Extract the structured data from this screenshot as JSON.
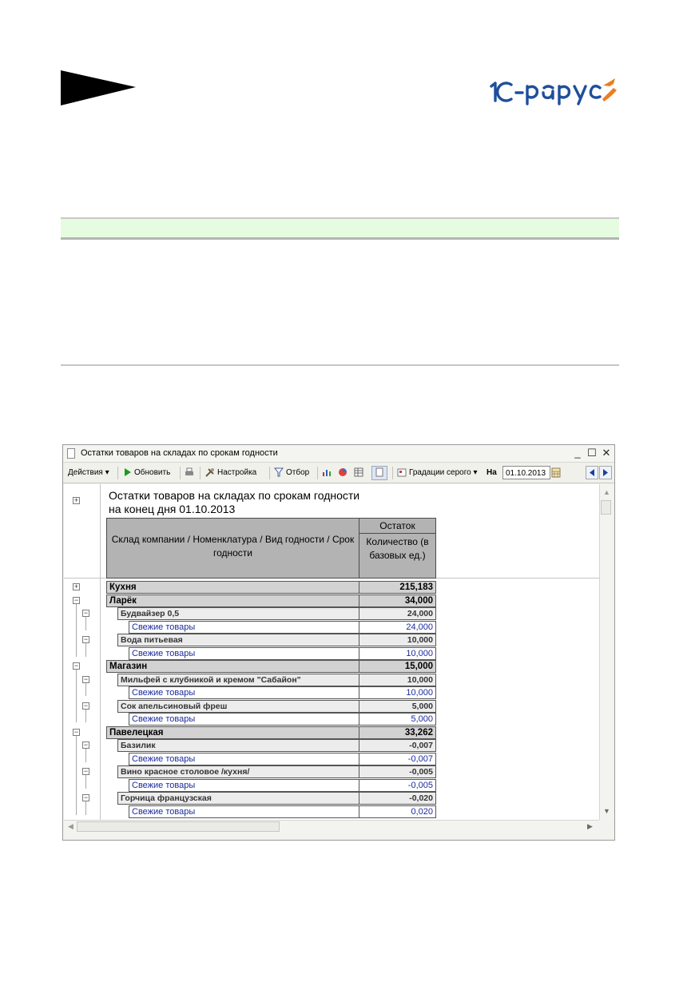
{
  "window": {
    "title": "Остатки товаров на складах по срокам годности"
  },
  "toolbar": {
    "actions": "Действия",
    "refresh": "Обновить",
    "settings": "Настройка",
    "filter": "Отбор",
    "grayscale": "Градации серого",
    "on_label": "На",
    "date": "01.10.2013"
  },
  "report": {
    "title_line1": "Остатки товаров на складах по срокам годности",
    "title_line2": "на конец дня 01.10.2013",
    "header_col1": "Склад компании / Номенклатура / Вид годности / Срок годности",
    "header_group": "Остаток",
    "header_col2": "Количество (в базовых ед.)",
    "rows": [
      {
        "level": 0,
        "name": "Кухня",
        "value": "215,183",
        "toggle": "+"
      },
      {
        "level": 0,
        "name": "Ларёк",
        "value": "34,000",
        "toggle": "−"
      },
      {
        "level": 1,
        "name": "Будвайзер 0,5",
        "value": "24,000",
        "toggle": "−"
      },
      {
        "level": 2,
        "name": "Свежие товары",
        "value": "24,000"
      },
      {
        "level": 1,
        "name": "Вода питьевая",
        "value": "10,000",
        "toggle": "−"
      },
      {
        "level": 2,
        "name": "Свежие товары",
        "value": "10,000"
      },
      {
        "level": 0,
        "name": "Магазин",
        "value": "15,000",
        "toggle": "−"
      },
      {
        "level": 1,
        "name": "Мильфей с клубникой и кремом \"Сабайон\"",
        "value": "10,000",
        "toggle": "−"
      },
      {
        "level": 2,
        "name": "Свежие товары",
        "value": "10,000"
      },
      {
        "level": 1,
        "name": "Сок апельсиновый фреш",
        "value": "5,000",
        "toggle": "−"
      },
      {
        "level": 2,
        "name": "Свежие товары",
        "value": "5,000"
      },
      {
        "level": 0,
        "name": "Павелецкая",
        "value": "33,262",
        "toggle": "−"
      },
      {
        "level": 1,
        "name": "Базилик",
        "value": "-0,007",
        "toggle": "−"
      },
      {
        "level": 2,
        "name": "Свежие товары",
        "value": "-0,007"
      },
      {
        "level": 1,
        "name": "Вино красное столовое /кухня/",
        "value": "-0,005",
        "toggle": "−"
      },
      {
        "level": 2,
        "name": "Свежие товары",
        "value": "-0,005"
      },
      {
        "level": 1,
        "name": "Горчица французская",
        "value": "-0,020",
        "toggle": "−"
      },
      {
        "level": 2,
        "name": "Свежие товары",
        "value": "0,020"
      }
    ]
  },
  "colors": {
    "band": "#e5fce0",
    "header_bg": "#b3b3b3",
    "link_text": "#1b2b9c",
    "logo_blue": "#1f4f9c",
    "logo_orange": "#ee7d1e"
  },
  "icons": [
    "arrow-shape",
    "1c-rarus-logo",
    "document-icon",
    "refresh-icon",
    "print-icon",
    "settings-icon",
    "filter-icon",
    "chart-icon",
    "calendar-icon"
  ]
}
